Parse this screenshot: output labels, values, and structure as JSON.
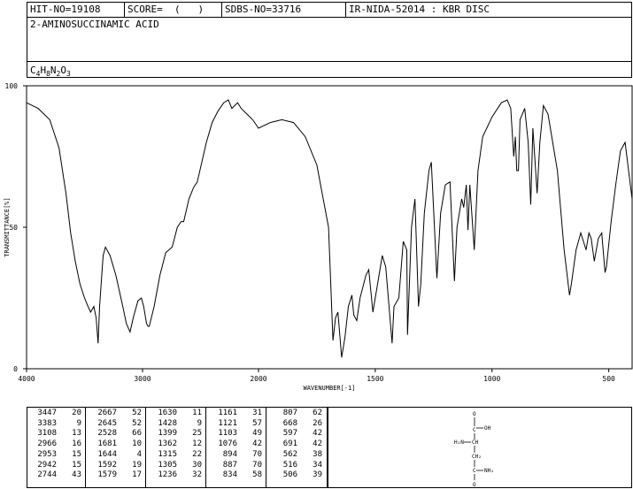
{
  "header": {
    "hit_no": "HIT-NO=19108",
    "score": "SCORE=  (   )",
    "sdbs_no": "SDBS-NO=33716",
    "method": "IR-NIDA-52014 : KBR DISC",
    "name": "2-AMINOSUCCINAMIC ACID",
    "formula_parts": [
      "C",
      "4",
      "H",
      "8",
      "N",
      "2",
      "O",
      "3"
    ]
  },
  "chart_data": {
    "type": "line",
    "title": "",
    "xlabel": "WAVENUMBER[-1]",
    "ylabel": "TRANSMITTANCE[%]",
    "xlim": [
      4000,
      400
    ],
    "ylim": [
      0,
      100
    ],
    "x_ticks": [
      4000,
      3000,
      2000,
      1500,
      1000,
      500
    ],
    "y_ticks": [
      0,
      50,
      100
    ],
    "series": [
      {
        "points": [
          [
            4000,
            94
          ],
          [
            3900,
            92
          ],
          [
            3800,
            88
          ],
          [
            3720,
            78
          ],
          [
            3660,
            62
          ],
          [
            3620,
            48
          ],
          [
            3580,
            38
          ],
          [
            3540,
            30
          ],
          [
            3500,
            25
          ],
          [
            3470,
            22
          ],
          [
            3447,
            20
          ],
          [
            3420,
            22
          ],
          [
            3400,
            18
          ],
          [
            3383,
            9
          ],
          [
            3370,
            22
          ],
          [
            3340,
            40
          ],
          [
            3320,
            43
          ],
          [
            3280,
            40
          ],
          [
            3230,
            33
          ],
          [
            3170,
            22
          ],
          [
            3140,
            16
          ],
          [
            3108,
            13
          ],
          [
            3080,
            18
          ],
          [
            3040,
            24
          ],
          [
            3010,
            25
          ],
          [
            2990,
            22
          ],
          [
            2966,
            16
          ],
          [
            2953,
            15
          ],
          [
            2942,
            15
          ],
          [
            2900,
            22
          ],
          [
            2850,
            33
          ],
          [
            2800,
            41
          ],
          [
            2744,
            43
          ],
          [
            2700,
            50
          ],
          [
            2667,
            52
          ],
          [
            2645,
            52
          ],
          [
            2600,
            60
          ],
          [
            2560,
            64
          ],
          [
            2528,
            66
          ],
          [
            2450,
            80
          ],
          [
            2400,
            87
          ],
          [
            2350,
            91
          ],
          [
            2300,
            94
          ],
          [
            2260,
            95
          ],
          [
            2230,
            92
          ],
          [
            2180,
            94
          ],
          [
            2150,
            92
          ],
          [
            2100,
            90
          ],
          [
            2050,
            88
          ],
          [
            2000,
            85
          ],
          [
            1950,
            87
          ],
          [
            1900,
            88
          ],
          [
            1850,
            87
          ],
          [
            1800,
            82
          ],
          [
            1750,
            72
          ],
          [
            1700,
            50
          ],
          [
            1681,
            10
          ],
          [
            1670,
            18
          ],
          [
            1660,
            20
          ],
          [
            1644,
            4
          ],
          [
            1630,
            11
          ],
          [
            1615,
            22
          ],
          [
            1600,
            26
          ],
          [
            1592,
            19
          ],
          [
            1579,
            17
          ],
          [
            1565,
            25
          ],
          [
            1540,
            33
          ],
          [
            1528,
            35
          ],
          [
            1510,
            20
          ],
          [
            1490,
            30
          ],
          [
            1470,
            40
          ],
          [
            1455,
            36
          ],
          [
            1428,
            9
          ],
          [
            1420,
            22
          ],
          [
            1399,
            25
          ],
          [
            1380,
            45
          ],
          [
            1365,
            42
          ],
          [
            1362,
            12
          ],
          [
            1345,
            50
          ],
          [
            1330,
            60
          ],
          [
            1315,
            22
          ],
          [
            1305,
            30
          ],
          [
            1290,
            55
          ],
          [
            1270,
            70
          ],
          [
            1260,
            73
          ],
          [
            1236,
            32
          ],
          [
            1220,
            55
          ],
          [
            1200,
            65
          ],
          [
            1180,
            66
          ],
          [
            1161,
            31
          ],
          [
            1150,
            50
          ],
          [
            1130,
            60
          ],
          [
            1121,
            57
          ],
          [
            1110,
            65
          ],
          [
            1103,
            49
          ],
          [
            1095,
            65
          ],
          [
            1076,
            42
          ],
          [
            1060,
            70
          ],
          [
            1040,
            82
          ],
          [
            1000,
            89
          ],
          [
            960,
            94
          ],
          [
            935,
            95
          ],
          [
            920,
            92
          ],
          [
            907,
            75
          ],
          [
            900,
            82
          ],
          [
            894,
            70
          ],
          [
            887,
            70
          ],
          [
            880,
            88
          ],
          [
            860,
            92
          ],
          [
            845,
            80
          ],
          [
            834,
            58
          ],
          [
            825,
            85
          ],
          [
            807,
            62
          ],
          [
            795,
            80
          ],
          [
            780,
            93
          ],
          [
            760,
            90
          ],
          [
            740,
            80
          ],
          [
            720,
            70
          ],
          [
            691,
            42
          ],
          [
            668,
            26
          ],
          [
            660,
            30
          ],
          [
            640,
            42
          ],
          [
            620,
            48
          ],
          [
            597,
            42
          ],
          [
            585,
            48
          ],
          [
            575,
            46
          ],
          [
            562,
            38
          ],
          [
            545,
            46
          ],
          [
            530,
            48
          ],
          [
            516,
            34
          ],
          [
            510,
            36
          ],
          [
            506,
            39
          ],
          [
            490,
            52
          ],
          [
            470,
            65
          ],
          [
            450,
            77
          ],
          [
            430,
            80
          ],
          [
            415,
            70
          ],
          [
            400,
            60
          ]
        ]
      }
    ]
  },
  "peaks": {
    "columns": [
      {
        "wn": [
          "3447",
          "3383",
          "3108",
          "2966",
          "2953",
          "2942",
          "2744"
        ],
        "t": [
          "20",
          "9",
          "13",
          "16",
          "15",
          "15",
          "43"
        ]
      },
      {
        "wn": [
          "2667",
          "2645",
          "2528",
          "1681",
          "1644",
          "1592",
          "1579"
        ],
        "t": [
          "52",
          "52",
          "66",
          "10",
          "4",
          "19",
          "17"
        ]
      },
      {
        "wn": [
          "1630",
          "1428",
          "1399",
          "1362",
          "1315",
          "1305",
          "1236"
        ],
        "t": [
          "11",
          "9",
          "25",
          "12",
          "22",
          "30",
          "32"
        ]
      },
      {
        "wn": [
          "1161",
          "1121",
          "1103",
          "1076",
          "894",
          "887",
          "834"
        ],
        "t": [
          "31",
          "57",
          "49",
          "42",
          "70",
          "70",
          "58"
        ]
      },
      {
        "wn": [
          "807",
          "668",
          "597",
          "691",
          "562",
          "516",
          "506"
        ],
        "t": [
          "62",
          "26",
          "42",
          "42",
          "38",
          "34",
          "39"
        ]
      }
    ]
  },
  "structure": {
    "o_label": "O",
    "oh_label": "OH",
    "h2n_label": "H₂N",
    "ch_label": "CH",
    "ch2_label": "CH₂",
    "o2_label": "O",
    "nh2_label": "NH₂"
  }
}
